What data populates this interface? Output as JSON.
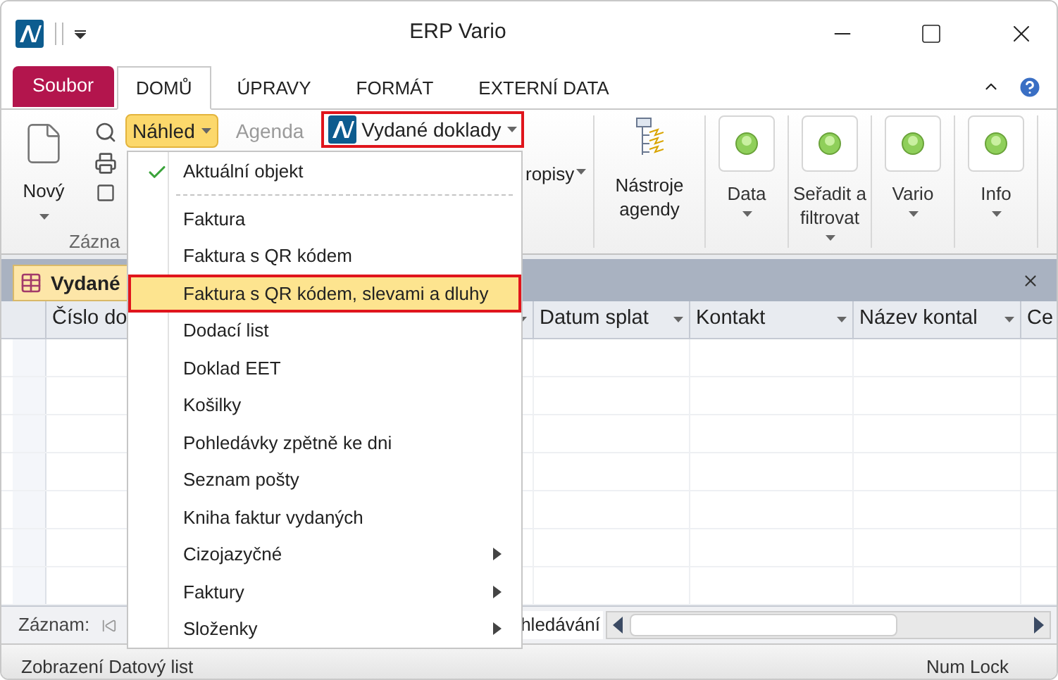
{
  "window": {
    "title": "ERP Vario"
  },
  "ribbon_tabs": [
    {
      "label": "Soubor",
      "kind": "file",
      "selected": false
    },
    {
      "label": "DOMŮ",
      "kind": "tab",
      "selected": true
    },
    {
      "label": "ÚPRAVY",
      "kind": "tab",
      "selected": false
    },
    {
      "label": "FORMÁT",
      "kind": "tab",
      "selected": false
    },
    {
      "label": "EXTERNÍ DATA",
      "kind": "tab",
      "selected": false
    }
  ],
  "ribbon": {
    "new_button": "Nový",
    "group_label": "Zázna",
    "preview_button": {
      "label": "Náhled",
      "expanded": true
    },
    "agenda_button": {
      "label": "Agenda",
      "disabled": true
    },
    "documents_button": {
      "label": "Vydané doklady",
      "outlined": true
    },
    "partial_button": "ropisy",
    "tools_button": "Nástroje agendy",
    "buttons": [
      {
        "label": "Data"
      },
      {
        "label": "Seřadit a filtrovat"
      },
      {
        "label": "Vario"
      },
      {
        "label": "Info"
      }
    ]
  },
  "menu": {
    "items": [
      {
        "label": "Aktuální objekt",
        "kind": "item",
        "checked": true,
        "selected": false
      },
      {
        "kind": "separator"
      },
      {
        "label": "Faktura",
        "kind": "item",
        "checked": false,
        "selected": false
      },
      {
        "label": "Faktura s QR kódem",
        "kind": "item",
        "checked": false,
        "selected": false
      },
      {
        "label": "Faktura s QR kódem, slevami a dluhy",
        "kind": "item",
        "checked": false,
        "selected": true
      },
      {
        "label": "Dodací list",
        "kind": "item",
        "checked": false,
        "selected": false
      },
      {
        "label": "Doklad EET",
        "kind": "item",
        "checked": false,
        "selected": false
      },
      {
        "label": "Košilky",
        "kind": "item",
        "checked": false,
        "selected": false
      },
      {
        "label": "Pohledávky zpětně ke dni",
        "kind": "item",
        "checked": false,
        "selected": false
      },
      {
        "label": "Seznam pošty",
        "kind": "item",
        "checked": false,
        "selected": false
      },
      {
        "label": "Kniha faktur vydaných",
        "kind": "item",
        "checked": false,
        "selected": false
      },
      {
        "label": "Cizojazyčné",
        "kind": "submenu",
        "checked": false,
        "selected": false
      },
      {
        "label": "Faktury",
        "kind": "submenu",
        "checked": false,
        "selected": false
      },
      {
        "label": "Složenky",
        "kind": "submenu",
        "checked": false,
        "selected": false
      }
    ]
  },
  "document": {
    "tab_label": "Vydané",
    "columns": [
      "Číslo do",
      "Datum splat",
      "Kontakt",
      "Název kontal",
      "Ce"
    ]
  },
  "navigation": {
    "label": "Záznam:",
    "search_label": "hledávání"
  },
  "status_bar": {
    "left": "Zobrazení Datový list",
    "right": "Num Lock"
  }
}
